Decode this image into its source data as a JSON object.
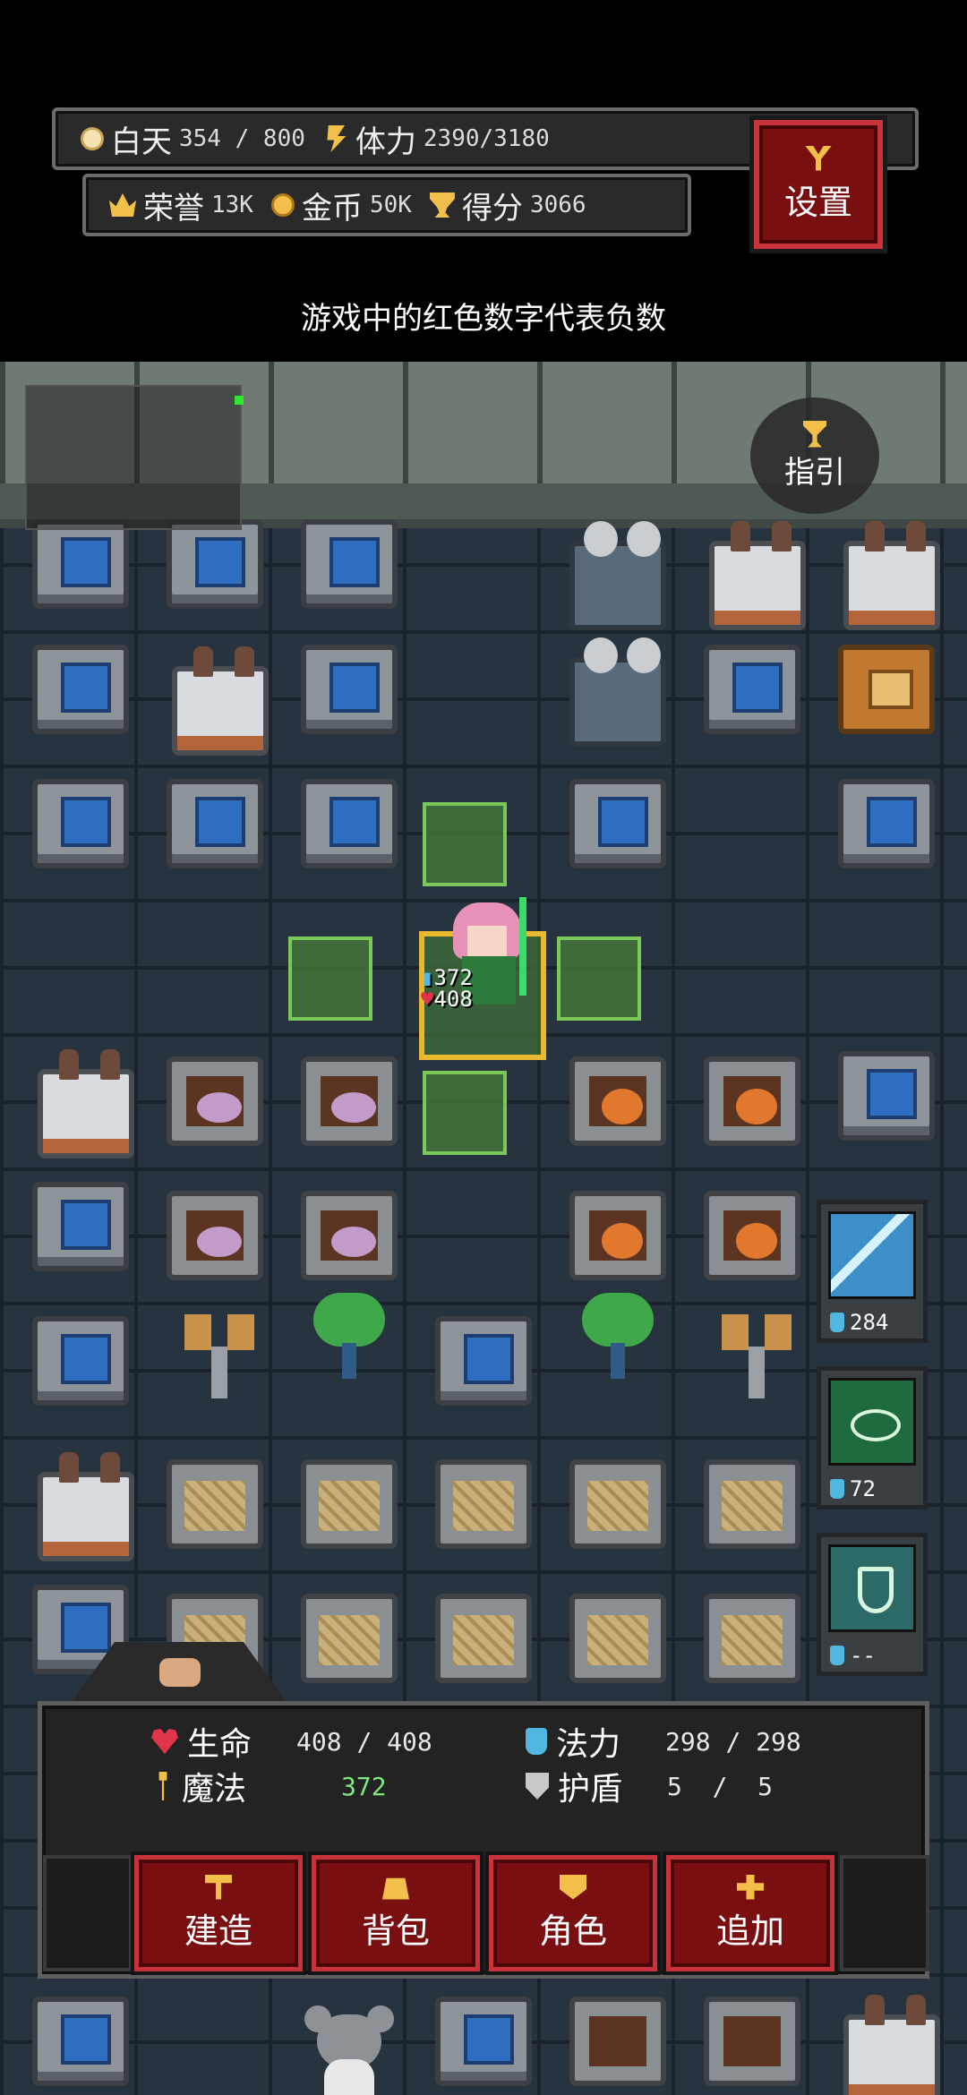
{
  "hud": {
    "day_label": "白天",
    "day_value": "354 / 800",
    "stamina_label": "体力",
    "stamina_value": "2390/3180",
    "honor_label": "荣誉",
    "honor_value": "13K",
    "gold_label": "金币",
    "gold_value": "50K",
    "score_label": "得分",
    "score_value": "3066",
    "settings_label": "设置"
  },
  "hint_text": "游戏中的红色数字代表负数",
  "guide_label": "指引",
  "player": {
    "mana_value": "372",
    "hp_value": "408"
  },
  "skills": [
    {
      "name": "lightning",
      "cost": "284"
    },
    {
      "name": "eye",
      "cost": "72"
    },
    {
      "name": "shield",
      "cost": "--"
    }
  ],
  "panel": {
    "hp_label": "生命",
    "hp_value": "408 / 408",
    "mp_label": "法力",
    "mp_value": "298 / 298",
    "magic_label": "魔法",
    "magic_value": "372",
    "shield_label": "护盾",
    "shield_value": "5  /  5"
  },
  "actions": {
    "build_label": "建造",
    "bag_label": "背包",
    "role_label": "角色",
    "add_label": "追加"
  },
  "colors": {
    "button_red": "#7a0f12",
    "highlight_green": "#487e3a",
    "selection_gold": "#e8b830"
  }
}
